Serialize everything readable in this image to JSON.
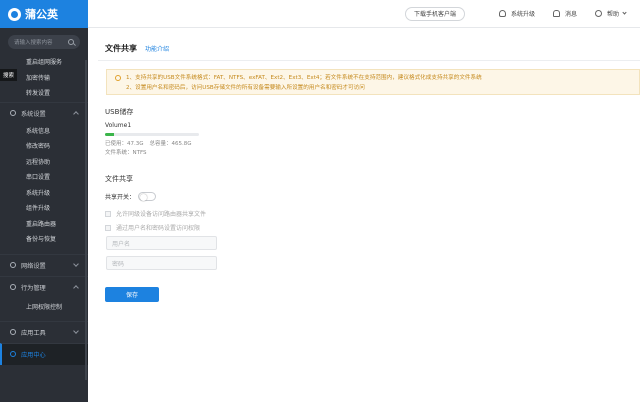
{
  "app": {
    "logo_text": "蒲公英"
  },
  "sidebar": {
    "search_placeholder": "请输入搜索内容",
    "search_tooltip": "搜索",
    "top_items": [
      "重启组网服务",
      "加密传输",
      "转发设置"
    ],
    "groups": {
      "system": {
        "label": "系统设置",
        "items": [
          "系统信息",
          "修改密码",
          "远程协助",
          "串口设置",
          "系统升级",
          "组件升级",
          "重启路由器",
          "备份与恢复"
        ]
      },
      "network": {
        "label": "网络设置"
      },
      "behavior": {
        "label": "行为管理",
        "items": [
          "上网权限控制"
        ]
      },
      "tools": {
        "label": "应用工具"
      },
      "appcenter": {
        "label": "应用中心"
      }
    }
  },
  "header": {
    "download_label": "下载手机客户端",
    "upgrade_label": "系统升级",
    "messages_label": "消息",
    "help_label": "帮助"
  },
  "page": {
    "title": "文件共享",
    "title_link": "功能介绍",
    "notice_lines": [
      "1、支持共享的USB文件系统格式：FAT、NTFS、exFAT、Ext2、Ext3、Ext4；若文件系统不在支持范围内，建议格式化成支持共享的文件系统",
      "2、设置用户名和密码后，访问USB存储文件的所有设备需要输入所设置的用户名和密码才可访问"
    ],
    "usb_section_title": "USB储存",
    "volume_name": "Volume1",
    "usage_fraction": 0.1,
    "used": "已使用：47.3G",
    "total": "总容量：465.8G",
    "filesystem": "文件系统：NTFS",
    "share_section_title": "文件共享",
    "share_switch_label": "共享开关：",
    "share_switch_on": false,
    "option_lan_access": "允许同级设备访问路由器共享文件",
    "option_auth": "通过用户名和密码设置访问权限",
    "username_placeholder": "用户名",
    "password_placeholder": "密码",
    "save_label": "保存"
  },
  "colors": {
    "accent": "#1d82e0",
    "sidebar_bg": "#2b2f36",
    "progress": "#3bb54a",
    "notice_text": "#c58a1d"
  },
  "icons": [
    "search-icon",
    "person-icon",
    "bell-icon",
    "help-icon",
    "settings-icon",
    "network-icon",
    "behavior-icon",
    "tools-icon",
    "app-center-icon",
    "warning-icon"
  ]
}
